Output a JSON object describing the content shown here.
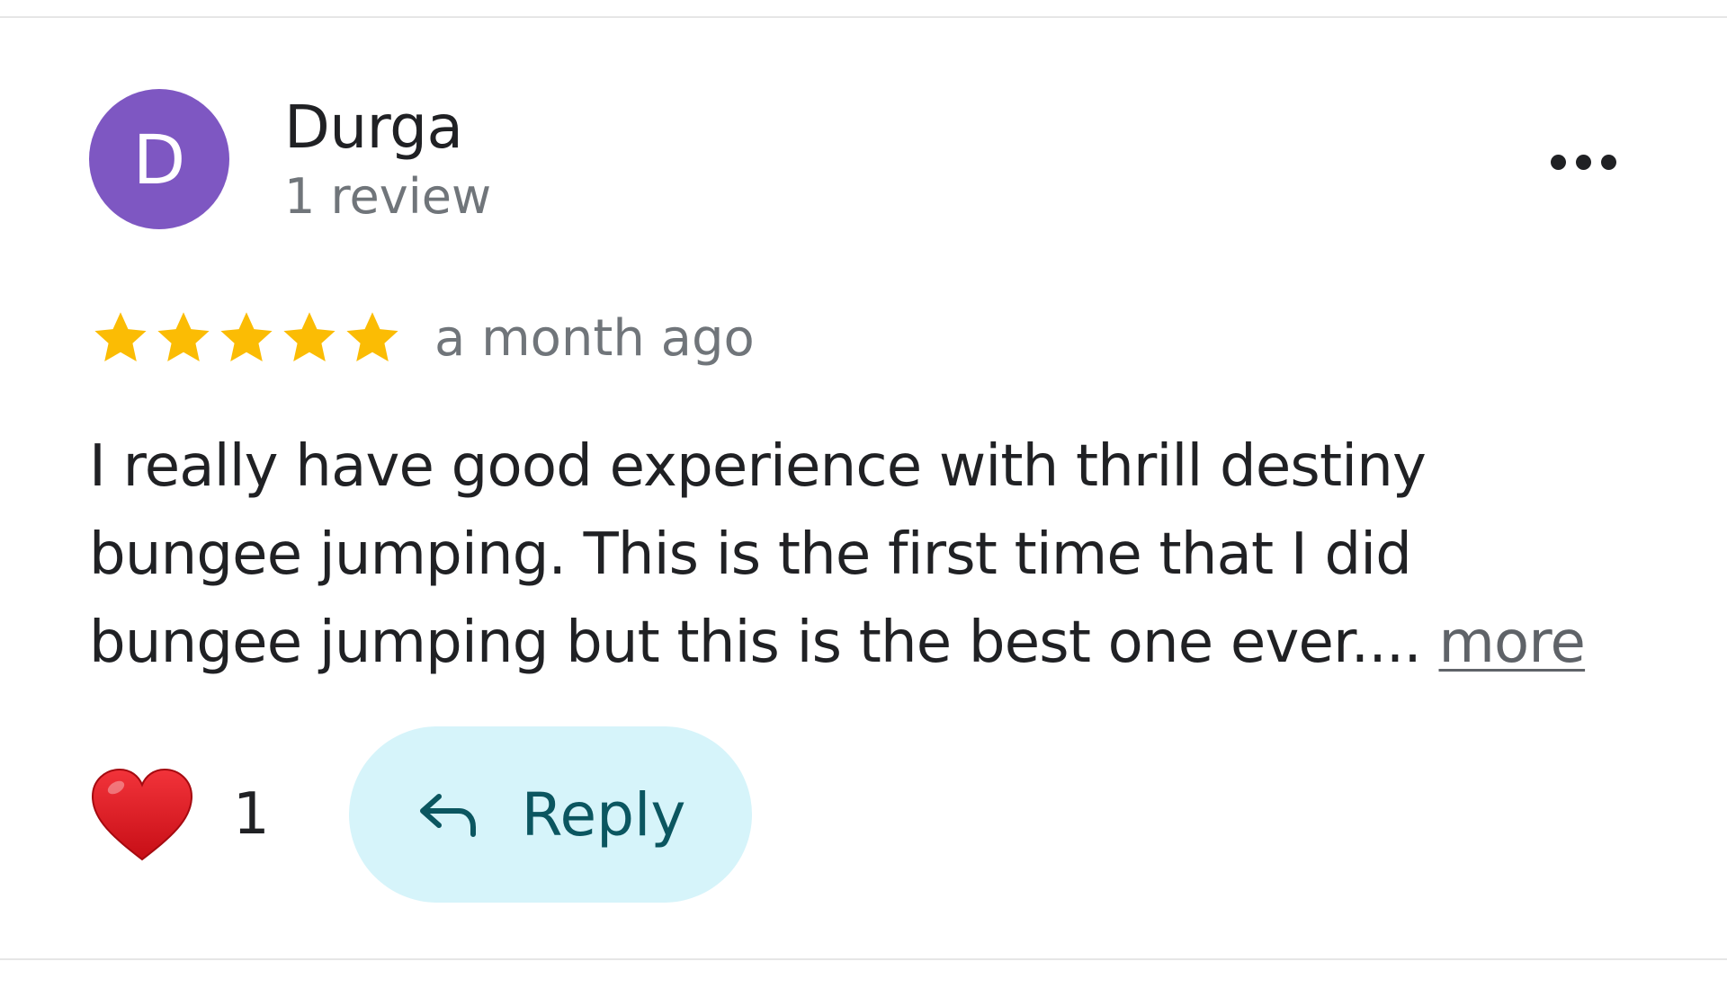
{
  "review": {
    "author": {
      "initial": "D",
      "name": "Durga",
      "review_count": "1 review",
      "avatar_color": "#7e57c2"
    },
    "menu_icon": "more-horizontal-icon",
    "rating": {
      "stars": 5,
      "max_stars": 5,
      "star_color": "#fbbc04",
      "star_icon": "star-icon"
    },
    "time": "a month ago",
    "text": "I really have good experience with thrill destiny bungee jumping. This is the first time that I did bungee jumping but this is the best one ever....",
    "more_label": "more",
    "likes": {
      "icon": "heart-icon",
      "count": "1",
      "color": "#e0161f"
    },
    "reply": {
      "icon": "reply-arrow-icon",
      "label": "Reply",
      "background": "#d6f4fa",
      "text_color": "#0b5660"
    }
  }
}
